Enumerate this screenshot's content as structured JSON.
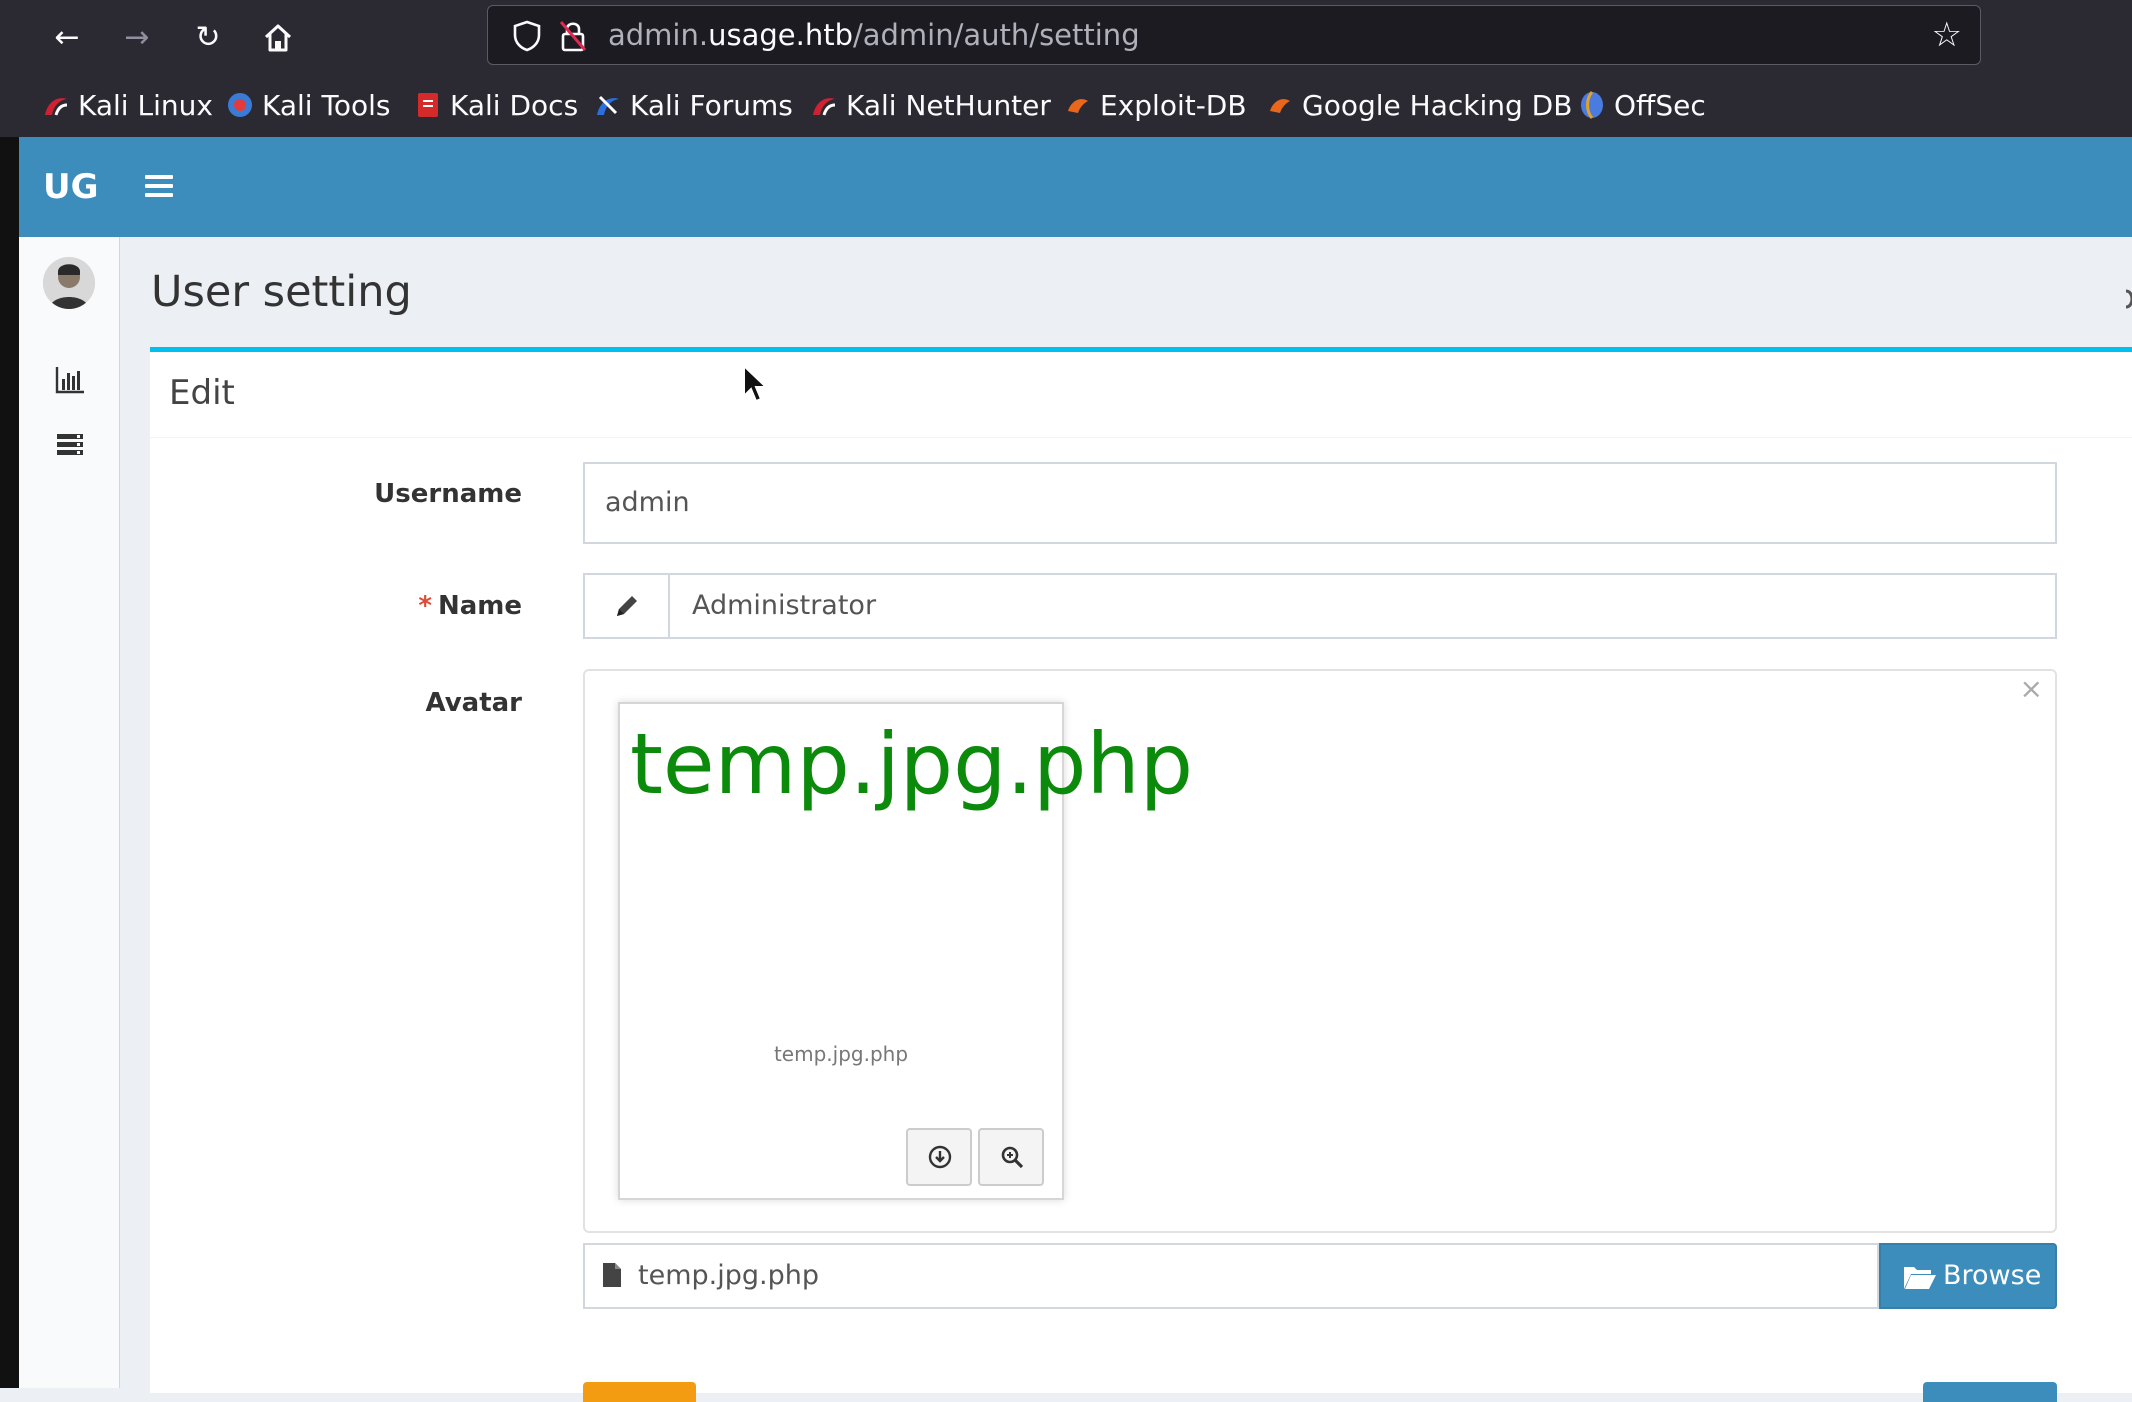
{
  "browser": {
    "url_domain_prefix": "admin.",
    "url_host": "usage.htb",
    "url_path": "/admin/auth/setting",
    "bookmarks": [
      {
        "label": "Kali Linux",
        "icon": "kali-dragon-icon"
      },
      {
        "label": "Kali Tools",
        "icon": "kali-tools-icon"
      },
      {
        "label": "Kali Docs",
        "icon": "kali-docs-icon"
      },
      {
        "label": "Kali Forums",
        "icon": "kali-forums-icon"
      },
      {
        "label": "Kali NetHunter",
        "icon": "kali-nethunter-icon"
      },
      {
        "label": "Exploit-DB",
        "icon": "exploit-db-icon"
      },
      {
        "label": "Google Hacking DB",
        "icon": "ghdb-icon"
      },
      {
        "label": "OffSec",
        "icon": "offsec-icon"
      }
    ]
  },
  "app": {
    "logo": "UG",
    "header_color": "#3c8dbc"
  },
  "page": {
    "title": "User setting",
    "box_title": "Edit"
  },
  "form": {
    "username_label": "Username",
    "username_value": "admin",
    "name_required_mark": "*",
    "name_label": "Name",
    "name_value": "Administrator",
    "avatar_label": "Avatar",
    "avatar_remove": "×",
    "preview_filename": "temp.jpg.php",
    "preview_caption": "temp.jpg.php",
    "file_name": "temp.jpg.php",
    "browse_label": "Browse"
  },
  "colors": {
    "accent": "#3c8dbc",
    "box_border": "#00c0ef",
    "preview_text": "#0b8a0b",
    "reset_button": "#f39c12"
  }
}
